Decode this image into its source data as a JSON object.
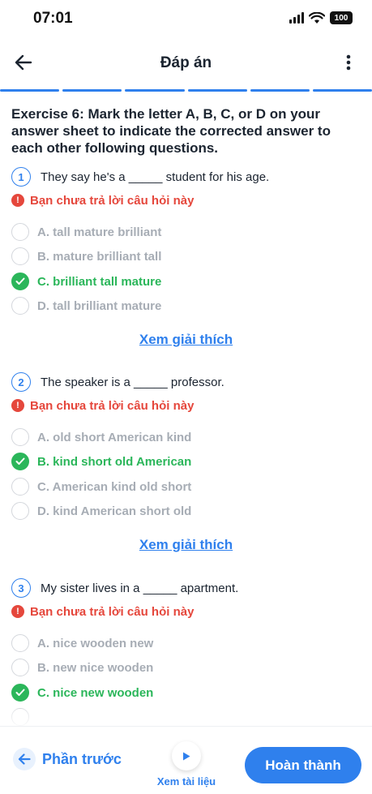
{
  "status_bar": {
    "time": "07:01",
    "battery": "100"
  },
  "header": {
    "title": "Đáp án"
  },
  "exercise": {
    "title": "Exercise 6: Mark the letter A, B, C, or D on your answer sheet to indicate the corrected answer to each other following questions."
  },
  "questions": [
    {
      "number": "1",
      "text": "They say he's a _____ student for his age.",
      "warning": "Bạn chưa trả lời câu hỏi này",
      "options": [
        {
          "label": "A. tall mature brilliant",
          "correct": false
        },
        {
          "label": "B. mature brilliant tall",
          "correct": false
        },
        {
          "label": "C. brilliant tall mature",
          "correct": true
        },
        {
          "label": "D. tall brilliant mature",
          "correct": false
        }
      ],
      "explain": "Xem giải thích"
    },
    {
      "number": "2",
      "text": "The speaker is a _____ professor.",
      "warning": "Bạn chưa trả lời câu hỏi này",
      "options": [
        {
          "label": "A. old short American kind",
          "correct": false
        },
        {
          "label": "B. kind short old American",
          "correct": true
        },
        {
          "label": "C. American kind old short",
          "correct": false
        },
        {
          "label": "D. kind American short old",
          "correct": false
        }
      ],
      "explain": "Xem giải thích"
    },
    {
      "number": "3",
      "text": "My sister lives in a _____ apartment.",
      "warning": "Bạn chưa trả lời câu hỏi này",
      "options": [
        {
          "label": "A. nice wooden new",
          "correct": false
        },
        {
          "label": "B. new nice wooden",
          "correct": false
        },
        {
          "label": "C. nice new wooden",
          "correct": true
        }
      ]
    }
  ],
  "footer": {
    "prev_label": "Phần trước",
    "doc_label": "Xem tài liệu",
    "done_label": "Hoàn thành"
  },
  "colors": {
    "accent": "#2f80ed",
    "correct": "#2bb65a",
    "warning": "#e5473c",
    "muted": "#a7adb5"
  }
}
